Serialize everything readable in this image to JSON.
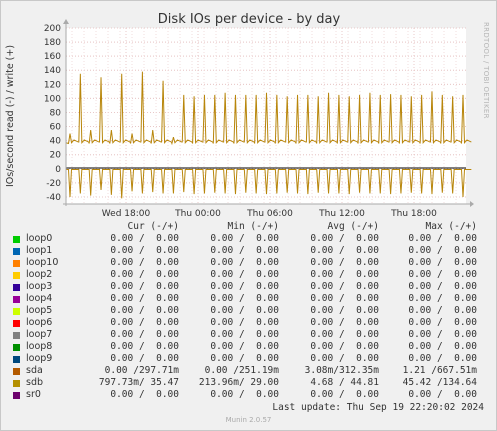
{
  "chart_data": {
    "type": "line",
    "title": "Disk IOs per device - by day",
    "ylabel": "IOs/second read (-) / write (+)",
    "ylim": [
      -50,
      200
    ],
    "yticks": [
      -40,
      -20,
      0,
      20,
      40,
      60,
      80,
      100,
      120,
      140,
      160,
      180,
      200
    ],
    "xticks": [
      "Wed 18:00",
      "Thu 00:00",
      "Thu 06:00",
      "Thu 12:00",
      "Thu 18:00"
    ],
    "grid": true,
    "sidebar_text": "RRDTOOL / TOBI OETIKER",
    "series": [
      {
        "name": "sdb",
        "color": "#b8860b",
        "write_baseline": 37,
        "write_spikes": [
          50,
          135,
          55,
          130,
          55,
          135,
          50,
          138,
          55,
          125,
          45,
          105,
          103,
          105,
          105,
          108,
          105,
          105,
          105,
          108,
          105,
          103,
          105,
          105,
          103,
          108,
          105,
          103,
          105,
          108,
          105,
          106,
          105,
          103,
          105,
          110,
          105,
          103,
          105
        ],
        "read_spikes": [
          -40,
          -35,
          -38,
          -30,
          -37,
          -42,
          -32,
          -35,
          -33,
          -35,
          -35,
          -33,
          -36,
          -35,
          -34,
          -35,
          -36,
          -34,
          -35,
          -36,
          -35,
          -34,
          -35,
          -36,
          -34,
          -35,
          -35,
          -36,
          -34,
          -35,
          -35,
          -36,
          -35,
          -34,
          -35,
          -36,
          -34,
          -35,
          -40
        ]
      }
    ]
  },
  "legend": {
    "headers": [
      "Cur (-/+)",
      "Min (-/+)",
      "Avg (-/+)",
      "Max (-/+)"
    ],
    "rows": [
      {
        "name": "loop0",
        "color": "#00cc00",
        "cur": "0.00 /  0.00",
        "min": "0.00 /  0.00",
        "avg": "0.00 /  0.00",
        "max": "0.00 /  0.00"
      },
      {
        "name": "loop1",
        "color": "#0066b3",
        "cur": "0.00 /  0.00",
        "min": "0.00 /  0.00",
        "avg": "0.00 /  0.00",
        "max": "0.00 /  0.00"
      },
      {
        "name": "loop10",
        "color": "#ff8000",
        "cur": "0.00 /  0.00",
        "min": "0.00 /  0.00",
        "avg": "0.00 /  0.00",
        "max": "0.00 /  0.00"
      },
      {
        "name": "loop2",
        "color": "#ffcc00",
        "cur": "0.00 /  0.00",
        "min": "0.00 /  0.00",
        "avg": "0.00 /  0.00",
        "max": "0.00 /  0.00"
      },
      {
        "name": "loop3",
        "color": "#330099",
        "cur": "0.00 /  0.00",
        "min": "0.00 /  0.00",
        "avg": "0.00 /  0.00",
        "max": "0.00 /  0.00"
      },
      {
        "name": "loop4",
        "color": "#990099",
        "cur": "0.00 /  0.00",
        "min": "0.00 /  0.00",
        "avg": "0.00 /  0.00",
        "max": "0.00 /  0.00"
      },
      {
        "name": "loop5",
        "color": "#ccff00",
        "cur": "0.00 /  0.00",
        "min": "0.00 /  0.00",
        "avg": "0.00 /  0.00",
        "max": "0.00 /  0.00"
      },
      {
        "name": "loop6",
        "color": "#ff0000",
        "cur": "0.00 /  0.00",
        "min": "0.00 /  0.00",
        "avg": "0.00 /  0.00",
        "max": "0.00 /  0.00"
      },
      {
        "name": "loop7",
        "color": "#808080",
        "cur": "0.00 /  0.00",
        "min": "0.00 /  0.00",
        "avg": "0.00 /  0.00",
        "max": "0.00 /  0.00"
      },
      {
        "name": "loop8",
        "color": "#008f00",
        "cur": "0.00 /  0.00",
        "min": "0.00 /  0.00",
        "avg": "0.00 /  0.00",
        "max": "0.00 /  0.00"
      },
      {
        "name": "loop9",
        "color": "#00487d",
        "cur": "0.00 /  0.00",
        "min": "0.00 /  0.00",
        "avg": "0.00 /  0.00",
        "max": "0.00 /  0.00"
      },
      {
        "name": "sda",
        "color": "#b35a00",
        "cur": "0.00 /297.71m",
        "min": "0.00 /251.19m",
        "avg": "3.08m/312.35m",
        "max": "1.21 /667.51m"
      },
      {
        "name": "sdb",
        "color": "#b38f00",
        "cur": "797.73m/ 35.47",
        "min": "213.96m/ 29.00",
        "avg": "4.68 / 44.81",
        "max": "45.42 /134.64"
      },
      {
        "name": "sr0",
        "color": "#6b006b",
        "cur": "0.00 /  0.00",
        "min": "0.00 /  0.00",
        "avg": "0.00 /  0.00",
        "max": "0.00 /  0.00"
      }
    ]
  },
  "last_update": "Last update: Thu Sep 19 22:20:02 2024",
  "footer": "Munin 2.0.57"
}
